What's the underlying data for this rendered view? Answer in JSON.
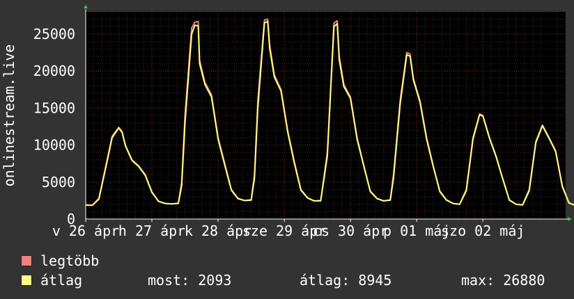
{
  "chart_data": {
    "type": "line",
    "ylabel": "onlinestream.live",
    "ylim": [
      0,
      28000
    ],
    "yticks": [
      0,
      5000,
      10000,
      15000,
      20000,
      25000
    ],
    "xlabels": [
      "v 26 ápr",
      "h 27 ápr",
      "k 28 ápr",
      "sze 29 ápr",
      "cs 30 ápr",
      "p 01 máj",
      "szo 02 máj"
    ],
    "x_start": 0,
    "x_end": 7.25,
    "grid": true,
    "legend_position": "bottom-left",
    "series": [
      {
        "name": "legtöbb",
        "color": "#f08080",
        "points": [
          [
            0.0,
            1900
          ],
          [
            0.1,
            1850
          ],
          [
            0.2,
            2800
          ],
          [
            0.3,
            7000
          ],
          [
            0.4,
            11200
          ],
          [
            0.5,
            12400
          ],
          [
            0.55,
            11800
          ],
          [
            0.6,
            10000
          ],
          [
            0.7,
            8000
          ],
          [
            0.8,
            7200
          ],
          [
            0.9,
            6000
          ],
          [
            1.0,
            3700
          ],
          [
            1.1,
            2400
          ],
          [
            1.2,
            2100
          ],
          [
            1.3,
            2050
          ],
          [
            1.4,
            2150
          ],
          [
            1.45,
            5000
          ],
          [
            1.5,
            14000
          ],
          [
            1.6,
            25800
          ],
          [
            1.65,
            26600
          ],
          [
            1.7,
            26700
          ],
          [
            1.72,
            21500
          ],
          [
            1.8,
            18500
          ],
          [
            1.9,
            16800
          ],
          [
            2.0,
            11000
          ],
          [
            2.1,
            7500
          ],
          [
            2.2,
            4000
          ],
          [
            2.3,
            2800
          ],
          [
            2.4,
            2500
          ],
          [
            2.5,
            2600
          ],
          [
            2.55,
            6000
          ],
          [
            2.6,
            16000
          ],
          [
            2.7,
            26900
          ],
          [
            2.75,
            27000
          ],
          [
            2.78,
            23500
          ],
          [
            2.85,
            19500
          ],
          [
            2.95,
            17500
          ],
          [
            3.05,
            12000
          ],
          [
            3.15,
            7800
          ],
          [
            3.25,
            4000
          ],
          [
            3.35,
            2900
          ],
          [
            3.45,
            2450
          ],
          [
            3.55,
            2500
          ],
          [
            3.65,
            9000
          ],
          [
            3.75,
            26500
          ],
          [
            3.8,
            26800
          ],
          [
            3.83,
            22000
          ],
          [
            3.9,
            18200
          ],
          [
            4.0,
            16500
          ],
          [
            4.1,
            11000
          ],
          [
            4.2,
            7300
          ],
          [
            4.3,
            3800
          ],
          [
            4.4,
            2800
          ],
          [
            4.5,
            2450
          ],
          [
            4.6,
            2600
          ],
          [
            4.65,
            6000
          ],
          [
            4.75,
            16000
          ],
          [
            4.85,
            22500
          ],
          [
            4.9,
            22300
          ],
          [
            4.95,
            19000
          ],
          [
            5.05,
            16000
          ],
          [
            5.15,
            11000
          ],
          [
            5.25,
            7200
          ],
          [
            5.35,
            3800
          ],
          [
            5.45,
            2600
          ],
          [
            5.55,
            2100
          ],
          [
            5.65,
            2000
          ],
          [
            5.75,
            4000
          ],
          [
            5.85,
            11000
          ],
          [
            5.95,
            14200
          ],
          [
            6.0,
            14000
          ],
          [
            6.1,
            11000
          ],
          [
            6.2,
            8500
          ],
          [
            6.3,
            5500
          ],
          [
            6.4,
            2600
          ],
          [
            6.5,
            2000
          ],
          [
            6.6,
            1900
          ],
          [
            6.7,
            4000
          ],
          [
            6.8,
            10500
          ],
          [
            6.9,
            12700
          ],
          [
            7.0,
            11000
          ],
          [
            7.1,
            9200
          ],
          [
            7.2,
            4500
          ],
          [
            7.3,
            2200
          ],
          [
            7.38,
            1900
          ]
        ]
      },
      {
        "name": "átlag",
        "color": "#ffff80",
        "points": [
          [
            0.0,
            1900
          ],
          [
            0.1,
            1850
          ],
          [
            0.2,
            2700
          ],
          [
            0.3,
            6800
          ],
          [
            0.4,
            11000
          ],
          [
            0.5,
            12300
          ],
          [
            0.55,
            11700
          ],
          [
            0.6,
            9900
          ],
          [
            0.7,
            7900
          ],
          [
            0.8,
            7100
          ],
          [
            0.9,
            5900
          ],
          [
            1.0,
            3600
          ],
          [
            1.1,
            2400
          ],
          [
            1.2,
            2100
          ],
          [
            1.3,
            2050
          ],
          [
            1.4,
            2100
          ],
          [
            1.45,
            4500
          ],
          [
            1.5,
            13000
          ],
          [
            1.6,
            25000
          ],
          [
            1.65,
            26200
          ],
          [
            1.7,
            26100
          ],
          [
            1.72,
            21000
          ],
          [
            1.8,
            18200
          ],
          [
            1.9,
            16500
          ],
          [
            2.0,
            10800
          ],
          [
            2.1,
            7300
          ],
          [
            2.2,
            3900
          ],
          [
            2.3,
            2750
          ],
          [
            2.4,
            2500
          ],
          [
            2.5,
            2550
          ],
          [
            2.55,
            5500
          ],
          [
            2.6,
            15000
          ],
          [
            2.7,
            26500
          ],
          [
            2.75,
            26700
          ],
          [
            2.78,
            23000
          ],
          [
            2.85,
            19200
          ],
          [
            2.95,
            17300
          ],
          [
            3.05,
            11800
          ],
          [
            3.15,
            7600
          ],
          [
            3.25,
            3900
          ],
          [
            3.35,
            2850
          ],
          [
            3.45,
            2450
          ],
          [
            3.55,
            2450
          ],
          [
            3.65,
            8500
          ],
          [
            3.75,
            26000
          ],
          [
            3.8,
            26400
          ],
          [
            3.83,
            21500
          ],
          [
            3.9,
            17900
          ],
          [
            4.0,
            16300
          ],
          [
            4.1,
            10800
          ],
          [
            4.2,
            7200
          ],
          [
            4.3,
            3700
          ],
          [
            4.4,
            2750
          ],
          [
            4.5,
            2450
          ],
          [
            4.6,
            2550
          ],
          [
            4.65,
            5500
          ],
          [
            4.75,
            15500
          ],
          [
            4.85,
            22200
          ],
          [
            4.9,
            22000
          ],
          [
            4.95,
            18800
          ],
          [
            5.05,
            15800
          ],
          [
            5.15,
            10800
          ],
          [
            5.25,
            7100
          ],
          [
            5.35,
            3700
          ],
          [
            5.45,
            2550
          ],
          [
            5.55,
            2100
          ],
          [
            5.65,
            2000
          ],
          [
            5.75,
            3800
          ],
          [
            5.85,
            10800
          ],
          [
            5.95,
            14100
          ],
          [
            6.0,
            13900
          ],
          [
            6.1,
            10900
          ],
          [
            6.2,
            8400
          ],
          [
            6.3,
            5400
          ],
          [
            6.4,
            2550
          ],
          [
            6.5,
            2000
          ],
          [
            6.6,
            1900
          ],
          [
            6.7,
            3800
          ],
          [
            6.8,
            10300
          ],
          [
            6.9,
            12600
          ],
          [
            7.0,
            10900
          ],
          [
            7.1,
            9100
          ],
          [
            7.2,
            4400
          ],
          [
            7.3,
            2150
          ],
          [
            7.38,
            1900
          ]
        ]
      }
    ]
  },
  "legend": [
    {
      "label": "legtöbb",
      "color": "#f08080"
    },
    {
      "label": "átlag",
      "color": "#ffff80"
    }
  ],
  "stats": {
    "now": "most: 2093",
    "avg": "átlag: 8945",
    "max": "max: 26880"
  }
}
